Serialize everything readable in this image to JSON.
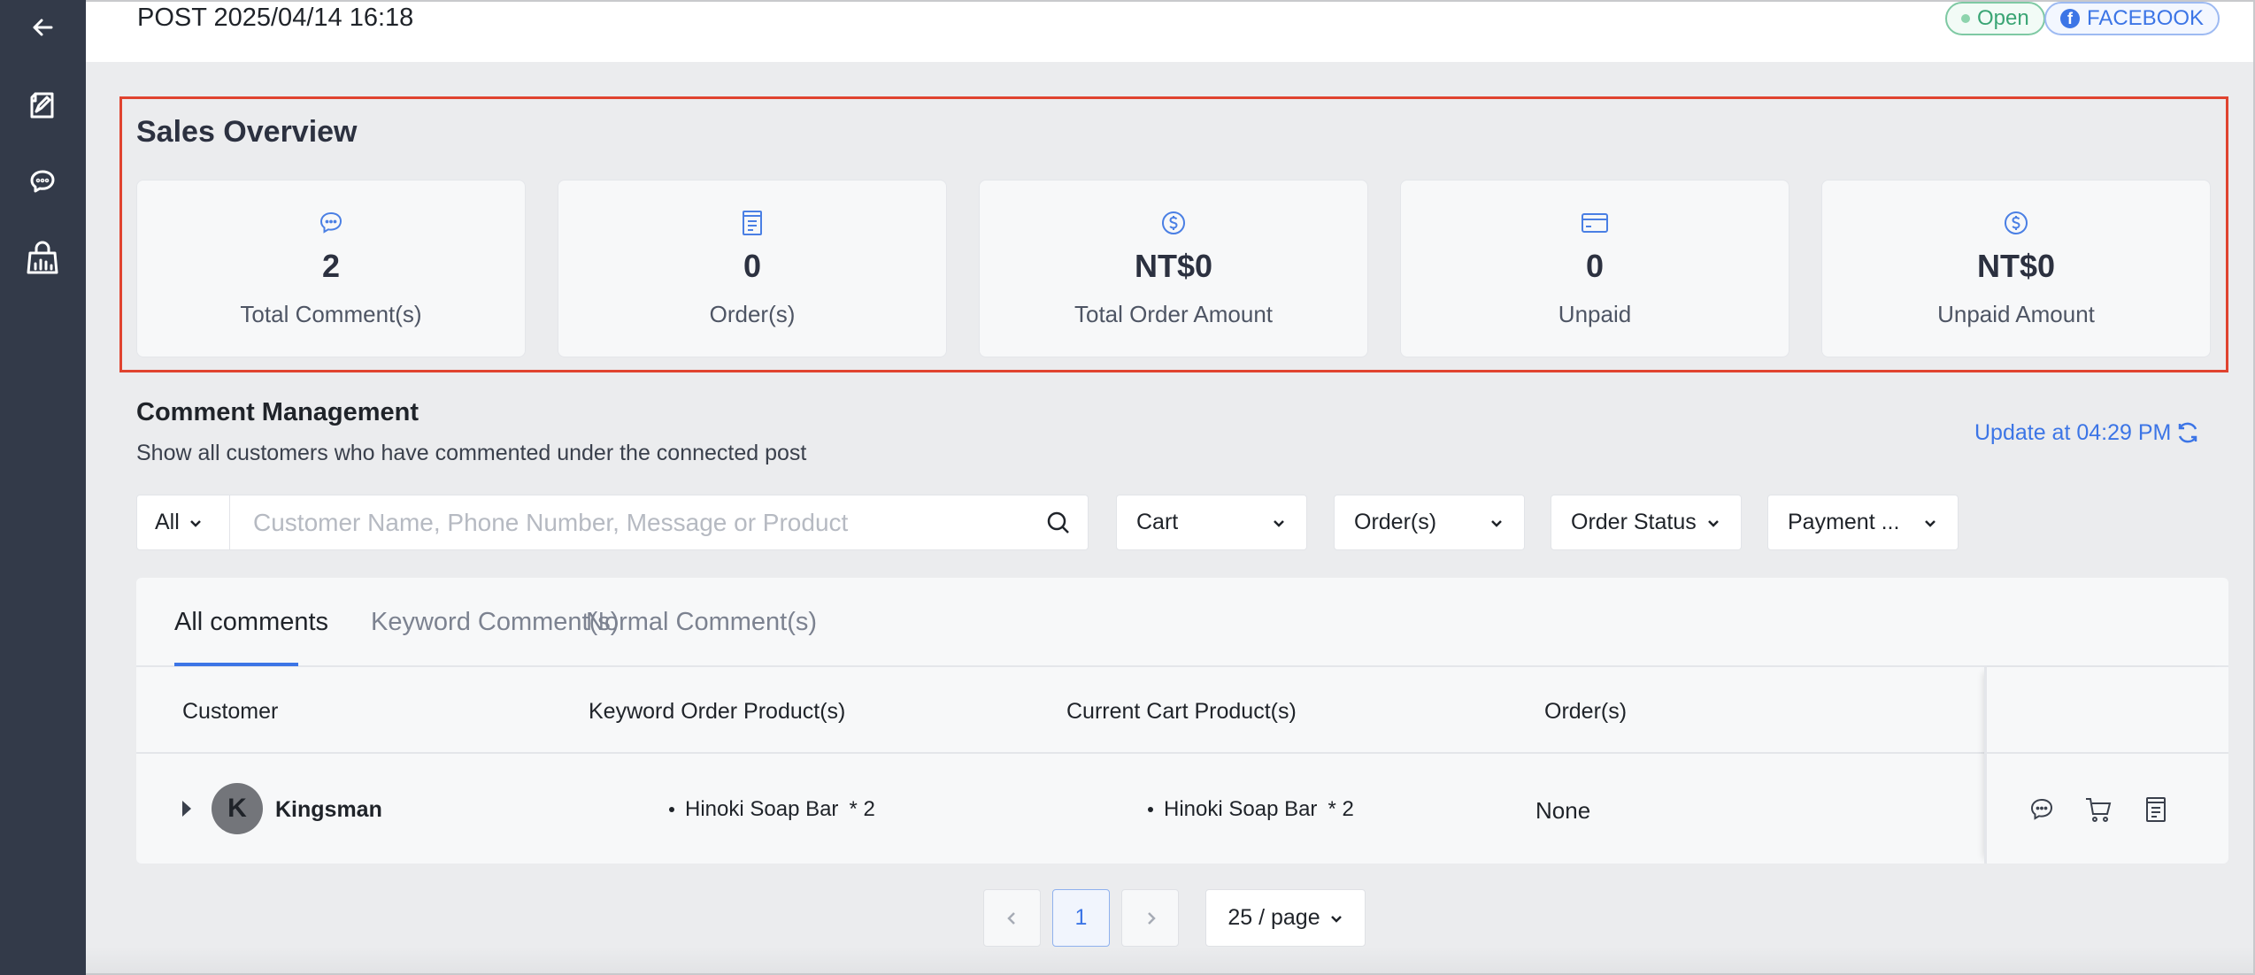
{
  "sidebar": {
    "items": [
      {
        "icon": "back-arrow-icon"
      },
      {
        "icon": "post-edit-icon"
      },
      {
        "icon": "chat-icon"
      },
      {
        "icon": "shopping-bag-chart-icon"
      }
    ]
  },
  "header": {
    "post_title": "POST 2025/04/14 16:18",
    "status_badge": "Open",
    "platform_badge": "FACEBOOK",
    "platform_logo_letter": "f"
  },
  "sales_overview": {
    "title": "Sales Overview",
    "cards": [
      {
        "icon": "comment-icon",
        "value": "2",
        "label": "Total Comment(s)"
      },
      {
        "icon": "order-receipt-icon",
        "value": "0",
        "label": "Order(s)"
      },
      {
        "icon": "dollar-icon",
        "value": "NT$0",
        "label": "Total Order Amount"
      },
      {
        "icon": "credit-card-icon",
        "value": "0",
        "label": "Unpaid"
      },
      {
        "icon": "dollar-icon",
        "value": "NT$0",
        "label": "Unpaid Amount"
      }
    ]
  },
  "comment_management": {
    "title": "Comment Management",
    "subtitle": "Show all customers who have commented under the connected post",
    "update_text": "Update at 04:29 PM",
    "filters": {
      "scope": "All",
      "search_placeholder": "Customer Name, Phone Number, Message or Product",
      "cart": "Cart",
      "orders": "Order(s)",
      "order_status": "Order Status",
      "payment": "Payment ..."
    },
    "tabs": [
      "All comments",
      "Keyword Comment(s)",
      "Normal Comment(s)"
    ],
    "active_tab": 0,
    "columns": [
      "Customer",
      "Keyword Order Product(s)",
      "Current Cart Product(s)",
      "Order(s)"
    ],
    "rows": [
      {
        "avatar_letter": "K",
        "customer": "Kingsman",
        "keyword_product": "Hinoki Soap Bar",
        "keyword_qty": "* 2",
        "cart_product": "Hinoki Soap Bar",
        "cart_qty": "* 2",
        "orders": "None"
      }
    ]
  },
  "pagination": {
    "current_page": "1",
    "page_size": "25 / page"
  },
  "colors": {
    "sidebar_bg": "#333a49",
    "accent": "#3c75e6",
    "highlight_border": "#e0432f",
    "open_green": "#3aa574"
  }
}
